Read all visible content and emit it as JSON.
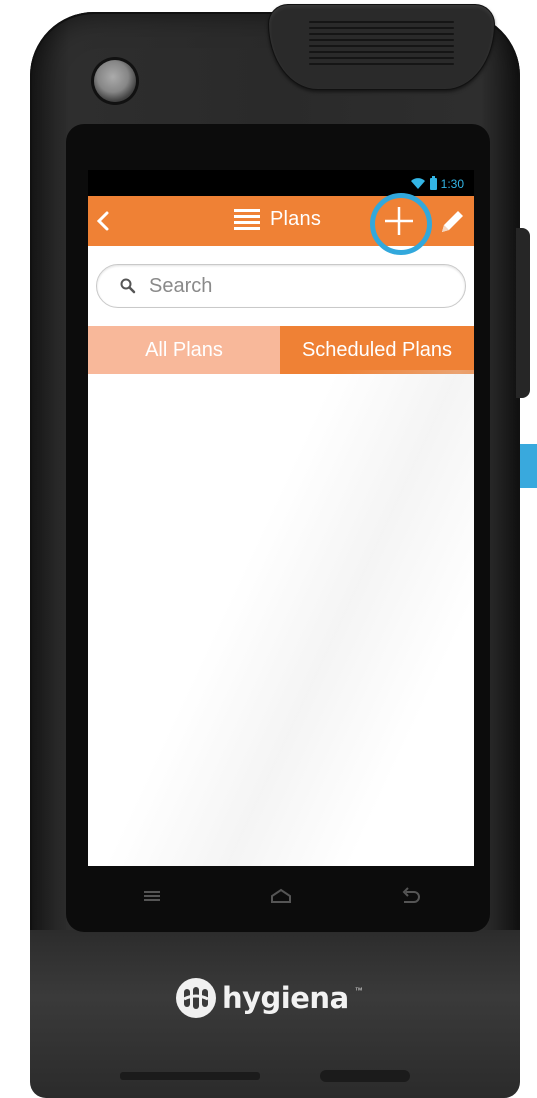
{
  "status_bar": {
    "time": "1:30"
  },
  "app_bar": {
    "title": "Plans",
    "add_label": "+"
  },
  "search": {
    "placeholder": "Search"
  },
  "tabs": [
    {
      "label": "All Plans",
      "selected": false
    },
    {
      "label": "Scheduled Plans",
      "selected": true
    }
  ],
  "brand": {
    "name": "hygiena",
    "trademark": "™"
  },
  "colors": {
    "app_bar": "#ef8135",
    "tab_inactive": "#f8b89a",
    "highlight_ring": "#32a8dc",
    "status_icons": "#33b5e5"
  },
  "icons": {
    "back": "chevron-left-icon",
    "menu": "hamburger-icon",
    "add": "plus-icon",
    "edit": "pencil-icon",
    "search": "magnifier-icon",
    "nav_menu": "menu-icon",
    "nav_home": "home-icon",
    "nav_back": "back-arrow-icon"
  }
}
